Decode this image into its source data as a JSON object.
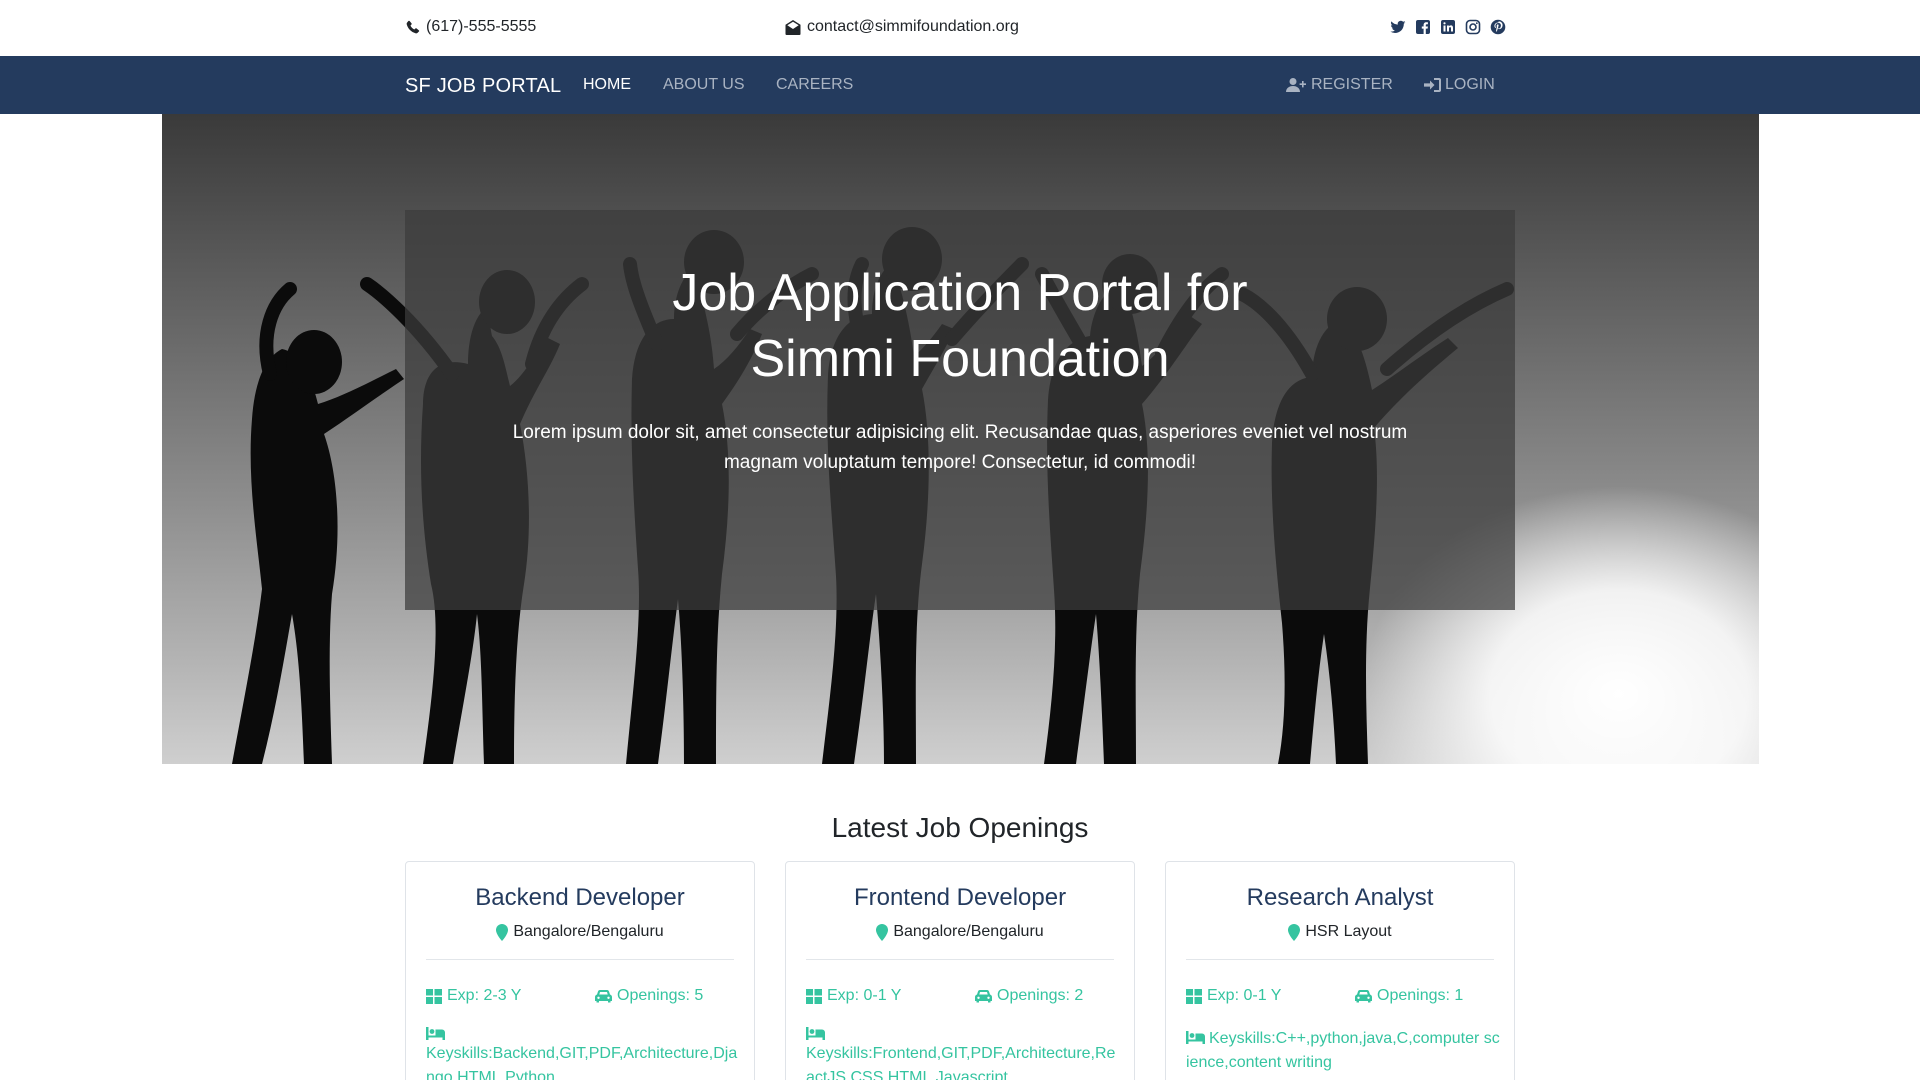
{
  "topbar": {
    "phone": "(617)-555-5555",
    "email": "contact@simmifoundation.org",
    "socials": [
      "twitter-icon",
      "facebook-icon",
      "linkedin-icon",
      "instagram-icon",
      "pinterest-icon"
    ]
  },
  "navbar": {
    "brand": "SF JOB PORTAL",
    "links": [
      "HOME",
      "ABOUT US",
      "CAREERS"
    ],
    "active": "HOME",
    "register": "REGISTER",
    "login": "LOGIN"
  },
  "hero": {
    "title_line1": "Job Application Portal for",
    "title_line2": "Simmi Foundation",
    "text": "Lorem ipsum dolor sit, amet consectetur adipisicing elit. Recusandae quas, asperiores eveniet vel nostrum magnam voluptatum tempore! Consectetur, id commodi!"
  },
  "openings": {
    "title": "Latest Job Openings",
    "jobs": [
      {
        "title": "Backend Developer",
        "location": "Bangalore/Bengaluru",
        "exp": "Exp: 2-3 Y",
        "openings": "Openings: 5",
        "keyskills": "Keyskills:Backend,GIT,PDF,Architecture,Django,HTML,Python"
      },
      {
        "title": "Frontend Developer",
        "location": "Bangalore/Bengaluru",
        "exp": "Exp: 0-1 Y",
        "openings": "Openings: 2",
        "keyskills": "Keyskills:Frontend,GIT,PDF,Architecture,ReactJS,CSS,HTML,Javascript"
      },
      {
        "title": "Research Analyst",
        "location": "HSR Layout",
        "exp": "Exp: 0-1 Y",
        "openings": "Openings: 1",
        "keyskills": "Keyskills:C++,python,java,C,computer science,content writing"
      }
    ]
  },
  "colors": {
    "navbar": "#243b5e",
    "accent": "#35c4a0",
    "hero_overlay": "rgba(60,60,60,0.72)"
  }
}
